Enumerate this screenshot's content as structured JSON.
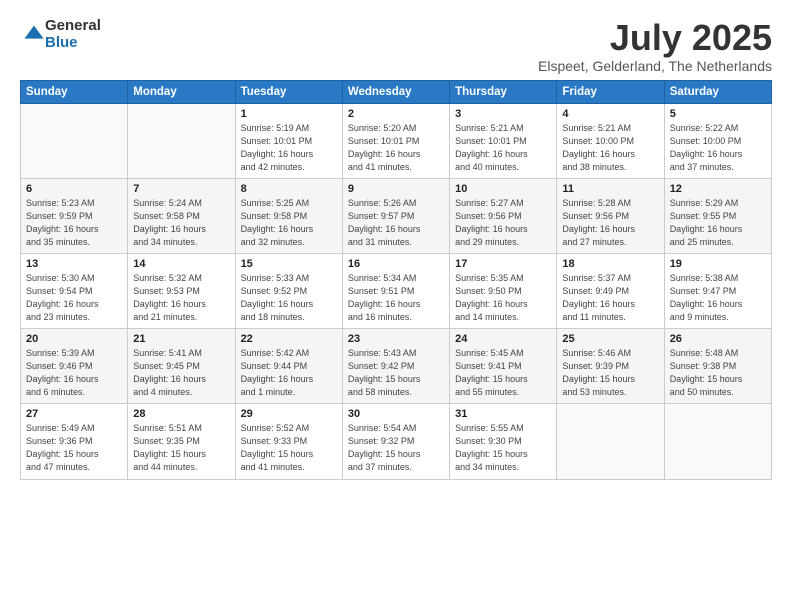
{
  "logo": {
    "general": "General",
    "blue": "Blue"
  },
  "title": "July 2025",
  "subtitle": "Elspeet, Gelderland, The Netherlands",
  "headers": [
    "Sunday",
    "Monday",
    "Tuesday",
    "Wednesday",
    "Thursday",
    "Friday",
    "Saturday"
  ],
  "weeks": [
    [
      {
        "day": "",
        "info": ""
      },
      {
        "day": "",
        "info": ""
      },
      {
        "day": "1",
        "info": "Sunrise: 5:19 AM\nSunset: 10:01 PM\nDaylight: 16 hours\nand 42 minutes."
      },
      {
        "day": "2",
        "info": "Sunrise: 5:20 AM\nSunset: 10:01 PM\nDaylight: 16 hours\nand 41 minutes."
      },
      {
        "day": "3",
        "info": "Sunrise: 5:21 AM\nSunset: 10:01 PM\nDaylight: 16 hours\nand 40 minutes."
      },
      {
        "day": "4",
        "info": "Sunrise: 5:21 AM\nSunset: 10:00 PM\nDaylight: 16 hours\nand 38 minutes."
      },
      {
        "day": "5",
        "info": "Sunrise: 5:22 AM\nSunset: 10:00 PM\nDaylight: 16 hours\nand 37 minutes."
      }
    ],
    [
      {
        "day": "6",
        "info": "Sunrise: 5:23 AM\nSunset: 9:59 PM\nDaylight: 16 hours\nand 35 minutes."
      },
      {
        "day": "7",
        "info": "Sunrise: 5:24 AM\nSunset: 9:58 PM\nDaylight: 16 hours\nand 34 minutes."
      },
      {
        "day": "8",
        "info": "Sunrise: 5:25 AM\nSunset: 9:58 PM\nDaylight: 16 hours\nand 32 minutes."
      },
      {
        "day": "9",
        "info": "Sunrise: 5:26 AM\nSunset: 9:57 PM\nDaylight: 16 hours\nand 31 minutes."
      },
      {
        "day": "10",
        "info": "Sunrise: 5:27 AM\nSunset: 9:56 PM\nDaylight: 16 hours\nand 29 minutes."
      },
      {
        "day": "11",
        "info": "Sunrise: 5:28 AM\nSunset: 9:56 PM\nDaylight: 16 hours\nand 27 minutes."
      },
      {
        "day": "12",
        "info": "Sunrise: 5:29 AM\nSunset: 9:55 PM\nDaylight: 16 hours\nand 25 minutes."
      }
    ],
    [
      {
        "day": "13",
        "info": "Sunrise: 5:30 AM\nSunset: 9:54 PM\nDaylight: 16 hours\nand 23 minutes."
      },
      {
        "day": "14",
        "info": "Sunrise: 5:32 AM\nSunset: 9:53 PM\nDaylight: 16 hours\nand 21 minutes."
      },
      {
        "day": "15",
        "info": "Sunrise: 5:33 AM\nSunset: 9:52 PM\nDaylight: 16 hours\nand 18 minutes."
      },
      {
        "day": "16",
        "info": "Sunrise: 5:34 AM\nSunset: 9:51 PM\nDaylight: 16 hours\nand 16 minutes."
      },
      {
        "day": "17",
        "info": "Sunrise: 5:35 AM\nSunset: 9:50 PM\nDaylight: 16 hours\nand 14 minutes."
      },
      {
        "day": "18",
        "info": "Sunrise: 5:37 AM\nSunset: 9:49 PM\nDaylight: 16 hours\nand 11 minutes."
      },
      {
        "day": "19",
        "info": "Sunrise: 5:38 AM\nSunset: 9:47 PM\nDaylight: 16 hours\nand 9 minutes."
      }
    ],
    [
      {
        "day": "20",
        "info": "Sunrise: 5:39 AM\nSunset: 9:46 PM\nDaylight: 16 hours\nand 6 minutes."
      },
      {
        "day": "21",
        "info": "Sunrise: 5:41 AM\nSunset: 9:45 PM\nDaylight: 16 hours\nand 4 minutes."
      },
      {
        "day": "22",
        "info": "Sunrise: 5:42 AM\nSunset: 9:44 PM\nDaylight: 16 hours\nand 1 minute."
      },
      {
        "day": "23",
        "info": "Sunrise: 5:43 AM\nSunset: 9:42 PM\nDaylight: 15 hours\nand 58 minutes."
      },
      {
        "day": "24",
        "info": "Sunrise: 5:45 AM\nSunset: 9:41 PM\nDaylight: 15 hours\nand 55 minutes."
      },
      {
        "day": "25",
        "info": "Sunrise: 5:46 AM\nSunset: 9:39 PM\nDaylight: 15 hours\nand 53 minutes."
      },
      {
        "day": "26",
        "info": "Sunrise: 5:48 AM\nSunset: 9:38 PM\nDaylight: 15 hours\nand 50 minutes."
      }
    ],
    [
      {
        "day": "27",
        "info": "Sunrise: 5:49 AM\nSunset: 9:36 PM\nDaylight: 15 hours\nand 47 minutes."
      },
      {
        "day": "28",
        "info": "Sunrise: 5:51 AM\nSunset: 9:35 PM\nDaylight: 15 hours\nand 44 minutes."
      },
      {
        "day": "29",
        "info": "Sunrise: 5:52 AM\nSunset: 9:33 PM\nDaylight: 15 hours\nand 41 minutes."
      },
      {
        "day": "30",
        "info": "Sunrise: 5:54 AM\nSunset: 9:32 PM\nDaylight: 15 hours\nand 37 minutes."
      },
      {
        "day": "31",
        "info": "Sunrise: 5:55 AM\nSunset: 9:30 PM\nDaylight: 15 hours\nand 34 minutes."
      },
      {
        "day": "",
        "info": ""
      },
      {
        "day": "",
        "info": ""
      }
    ]
  ]
}
